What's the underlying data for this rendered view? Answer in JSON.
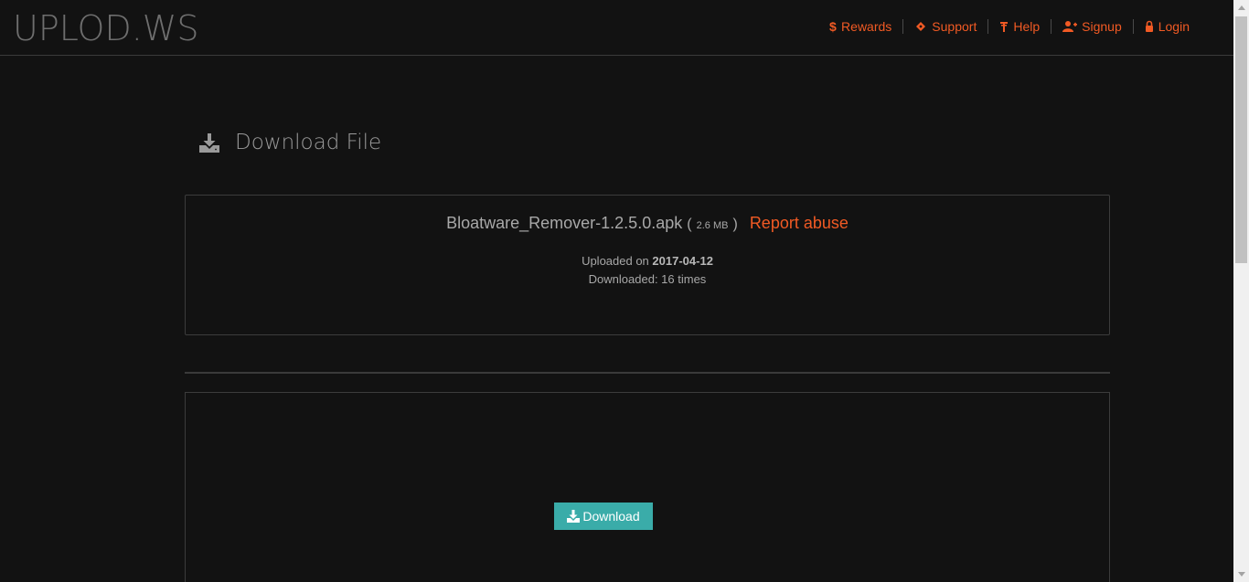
{
  "header": {
    "logo": "UPLOD.WS",
    "nav": [
      {
        "label": "Rewards",
        "icon": "dollar-icon"
      },
      {
        "label": "Support",
        "icon": "ticket-icon"
      },
      {
        "label": "Help",
        "icon": "help-icon"
      },
      {
        "label": "Signup",
        "icon": "user-plus-icon"
      },
      {
        "label": "Login",
        "icon": "lock-icon"
      }
    ]
  },
  "main": {
    "heading": "Download File",
    "file": {
      "name": "Bloatware_Remover-1.2.5.0.apk",
      "open_paren": "(",
      "size": "2.6 MB",
      "close_paren": ")",
      "report_label": "Report abuse",
      "uploaded_prefix": "Uploaded on",
      "uploaded_date": "2017-04-12",
      "downloaded_text": "Downloaded: 16 times"
    },
    "download_button": "Download"
  },
  "colors": {
    "accent": "#f15a24",
    "button": "#3aaca9",
    "background": "#121212"
  }
}
